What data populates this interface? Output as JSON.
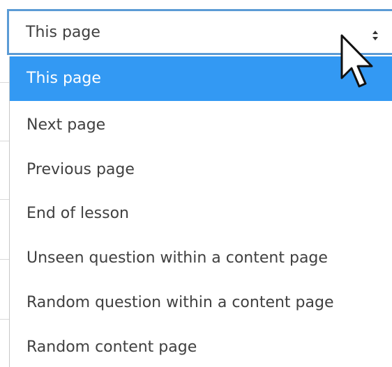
{
  "select": {
    "value": "This page",
    "arrow_icon": "sort-arrows-icon"
  },
  "dropdown": {
    "options": [
      {
        "label": "This page",
        "selected": true
      },
      {
        "label": "Next page",
        "selected": false
      },
      {
        "label": "Previous page",
        "selected": false
      },
      {
        "label": "End of lesson",
        "selected": false
      },
      {
        "label": "Unseen question within a content page",
        "selected": false
      },
      {
        "label": "Random question within a content page",
        "selected": false
      },
      {
        "label": "Random content page",
        "selected": false
      }
    ]
  },
  "cursor_icon": "mouse-pointer-icon",
  "colors": {
    "focus_border": "#5b9bd5",
    "selected_bg": "#3399f3",
    "text": "#404040"
  }
}
